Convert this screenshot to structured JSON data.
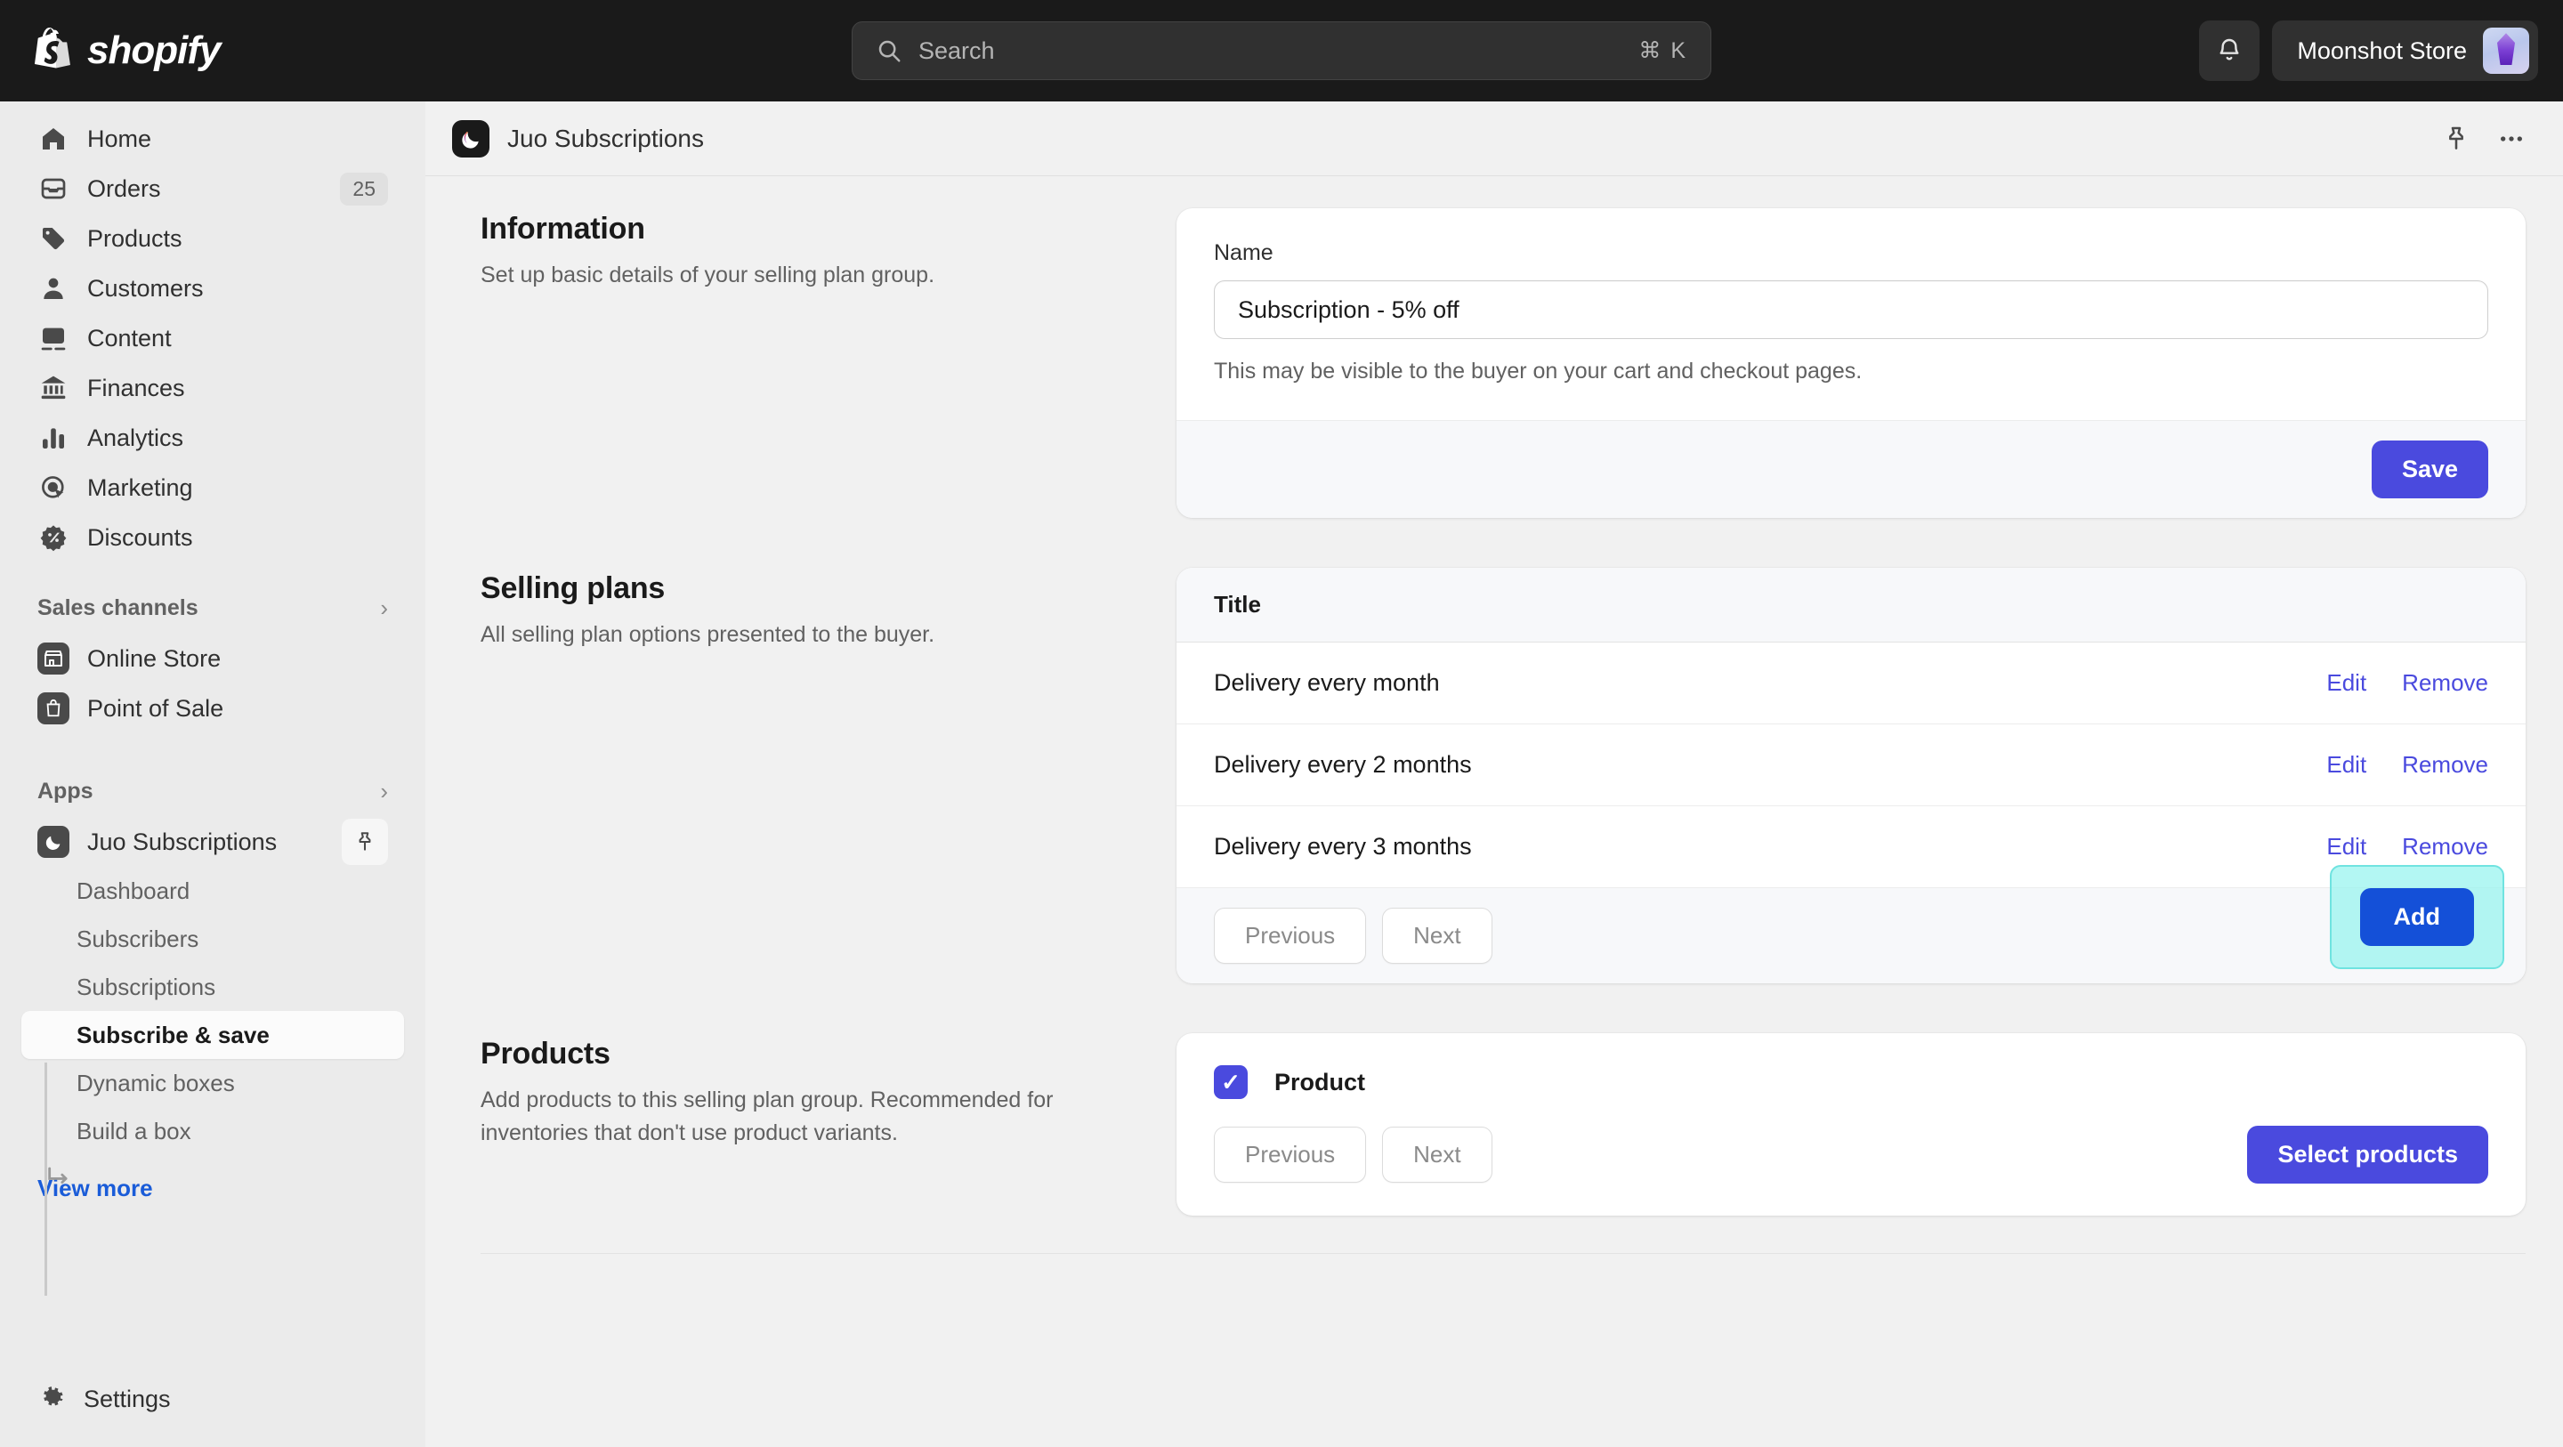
{
  "topbar": {
    "brand": "shopify",
    "search": {
      "placeholder": "Search",
      "shortcut": "⌘ K",
      "icon": "search-icon"
    },
    "notifications_icon": "bell-icon",
    "store_name": "Moonshot Store"
  },
  "sidebar": {
    "primary": [
      {
        "label": "Home",
        "icon": "home-icon",
        "badge": ""
      },
      {
        "label": "Orders",
        "icon": "orders-inbox-icon",
        "badge": "25"
      },
      {
        "label": "Products",
        "icon": "tag-icon",
        "badge": ""
      },
      {
        "label": "Customers",
        "icon": "person-icon",
        "badge": ""
      },
      {
        "label": "Content",
        "icon": "image-icon",
        "badge": ""
      },
      {
        "label": "Finances",
        "icon": "bank-icon",
        "badge": ""
      },
      {
        "label": "Analytics",
        "icon": "bar-chart-icon",
        "badge": ""
      },
      {
        "label": "Marketing",
        "icon": "target-cursor-icon",
        "badge": ""
      },
      {
        "label": "Discounts",
        "icon": "discount-badge-icon",
        "badge": ""
      }
    ],
    "sales_channels": {
      "title": "Sales channels",
      "chevron": "›",
      "items": [
        {
          "label": "Online Store",
          "icon": "storefront-icon"
        },
        {
          "label": "Point of Sale",
          "icon": "pos-bag-icon"
        }
      ]
    },
    "apps": {
      "title": "Apps",
      "chevron": "›",
      "app_name": "Juo Subscriptions",
      "app_icon": "moon-icon",
      "pin_icon": "pin-icon",
      "sub_items": [
        {
          "label": "Dashboard",
          "active": false
        },
        {
          "label": "Subscribers",
          "active": false
        },
        {
          "label": "Subscriptions",
          "active": false
        },
        {
          "label": "Subscribe & save",
          "active": true
        },
        {
          "label": "Dynamic boxes",
          "active": false
        },
        {
          "label": "Build a box",
          "active": false
        }
      ],
      "view_more": "View more"
    },
    "settings": {
      "label": "Settings",
      "icon": "gear-icon"
    }
  },
  "app_header": {
    "title": "Juo Subscriptions",
    "app_icon": "moon-icon",
    "pin_icon": "pin-icon",
    "more_icon": "ellipsis-icon"
  },
  "information": {
    "title": "Information",
    "description": "Set up basic details of your selling plan group.",
    "name_label": "Name",
    "name_value": "Subscription - 5% off",
    "name_placeholder": "Subscription - 5% off",
    "help_text": "This may be visible to the buyer on your cart and checkout pages.",
    "save_label": "Save"
  },
  "selling_plans": {
    "title": "Selling plans",
    "description": "All selling plan options presented to the buyer.",
    "column_header": "Title",
    "rows": [
      {
        "title": "Delivery every month",
        "edit": "Edit",
        "remove": "Remove"
      },
      {
        "title": "Delivery every 2 months",
        "edit": "Edit",
        "remove": "Remove"
      },
      {
        "title": "Delivery every 3 months",
        "edit": "Edit",
        "remove": "Remove"
      }
    ],
    "previous_label": "Previous",
    "next_label": "Next",
    "add_label": "Add"
  },
  "products": {
    "title": "Products",
    "description": "Add products to this selling plan group. Recommended for inventories that don't use product variants.",
    "checkbox_label": "Product",
    "checkbox_checked": true,
    "previous_label": "Previous",
    "next_label": "Next",
    "select_label": "Select products"
  },
  "colors": {
    "topbar_bg": "#1a1a1a",
    "primary": "#4a4ade",
    "add_button": "#1450d8",
    "highlight": "#96f4ee",
    "link": "#1a5cd8"
  }
}
